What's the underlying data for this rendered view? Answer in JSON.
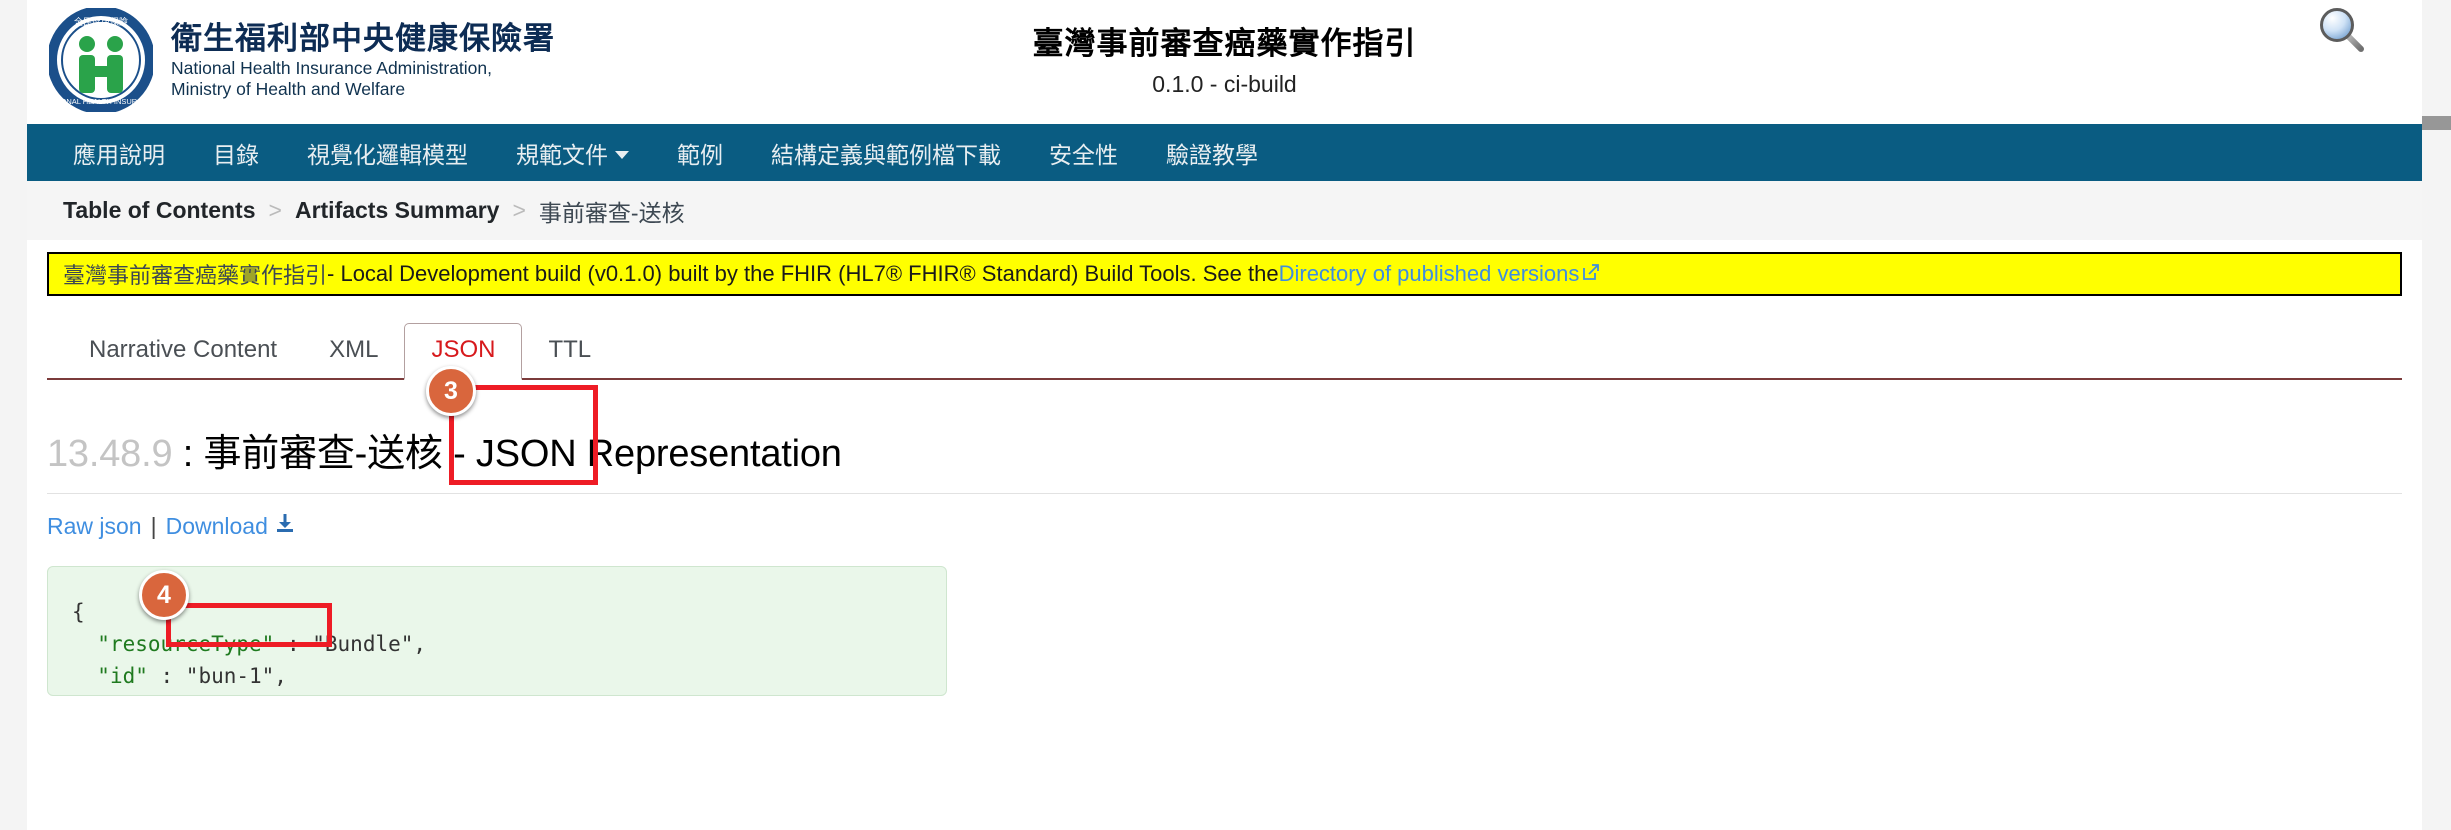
{
  "branding": {
    "org_zh": "衛生福利部中央健康保險署",
    "org_en_line1": "National Health Insurance Administration,",
    "org_en_line2": "Ministry of Health and Welfare",
    "seal_icon": "nhi-seal-logo",
    "search_icon": "search-icon"
  },
  "header": {
    "title": "臺灣事前審查癌藥實作指引",
    "version": "0.1.0 - ci-build"
  },
  "nav": {
    "items": [
      {
        "label": "應用說明",
        "has_dropdown": false
      },
      {
        "label": "目錄",
        "has_dropdown": false
      },
      {
        "label": "視覺化邏輯模型",
        "has_dropdown": false
      },
      {
        "label": "規範文件",
        "has_dropdown": true
      },
      {
        "label": "範例",
        "has_dropdown": false
      },
      {
        "label": "結構定義與範例檔下載",
        "has_dropdown": false
      },
      {
        "label": "安全性",
        "has_dropdown": false
      },
      {
        "label": "驗證教學",
        "has_dropdown": false
      }
    ]
  },
  "breadcrumb": {
    "separator": ">",
    "items": [
      {
        "label": "Table of Contents",
        "current": false
      },
      {
        "label": "Artifacts Summary",
        "current": false
      },
      {
        "label": "事前審查-送核",
        "current": true
      }
    ]
  },
  "banner": {
    "ig_title": "臺灣事前審查癌藥實作指引",
    "text": " - Local Development build (v0.1.0) built by the FHIR (HL7® FHIR® Standard) Build Tools. See the ",
    "link_label": "Directory of published versions",
    "external_icon": "external-link-icon",
    "bg_color": "#ffff00"
  },
  "tabs": {
    "items": [
      {
        "label": "Narrative Content",
        "active": false
      },
      {
        "label": "XML",
        "active": false
      },
      {
        "label": "JSON",
        "active": true
      },
      {
        "label": "TTL",
        "active": false
      }
    ],
    "active_color": "#d7191c"
  },
  "main": {
    "section_number": "13.48.9",
    "heading_rest": " : 事前審查-送核 - JSON Representation",
    "raw_link": "Raw json",
    "separator": "|",
    "download_link": "Download",
    "download_icon": "download-icon"
  },
  "code": {
    "line1": "{",
    "line2_key": "\"resourceType\"",
    "line2_rest": " : \"Bundle\",",
    "line3_key": "\"id\"",
    "line3_rest": " : \"bun-1\","
  },
  "annotations": [
    {
      "number": "3",
      "target": "json-tab"
    },
    {
      "number": "4",
      "target": "download-link"
    }
  ]
}
